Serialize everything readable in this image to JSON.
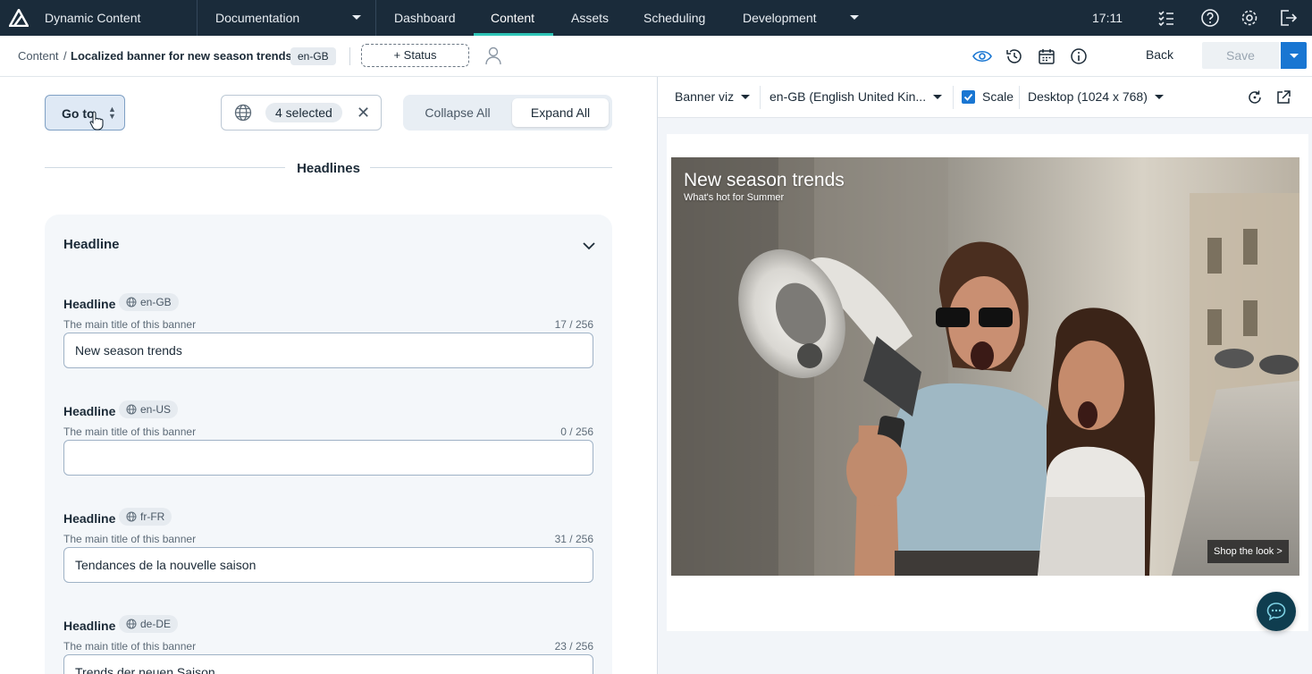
{
  "topnav": {
    "app_name": "Dynamic Content",
    "items": [
      "Documentation",
      "Dashboard",
      "Content",
      "Assets",
      "Scheduling",
      "Development"
    ],
    "active_item": "Content",
    "clock": "17:11",
    "icons": [
      "logo-icon",
      "tasks-icon",
      "help-icon",
      "gear-icon",
      "logout-icon"
    ]
  },
  "breadcrumb": {
    "root": "Content",
    "separator": "/",
    "current": "Localized banner for new season trends",
    "locale": "en-GB",
    "status_button": "+ Status"
  },
  "actions": {
    "back": "Back",
    "save": "Save",
    "icons": [
      "eye-icon",
      "history-icon",
      "calendar-icon",
      "info-icon"
    ]
  },
  "toolbar": {
    "goto": "Go to",
    "locales_selected": "4 selected",
    "collapse_all": "Collapse All",
    "expand_all": "Expand All"
  },
  "section": {
    "title": "Headlines",
    "card_title": "Headline",
    "fields": [
      {
        "label": "Headline",
        "locale": "en-GB",
        "description": "The main title of this banner",
        "count": "17 / 256",
        "value": "New season trends"
      },
      {
        "label": "Headline",
        "locale": "en-US",
        "description": "The main title of this banner",
        "count": "0 / 256",
        "value": ""
      },
      {
        "label": "Headline",
        "locale": "fr-FR",
        "description": "The main title of this banner",
        "count": "31 / 256",
        "value": "Tendances de la nouvelle saison"
      },
      {
        "label": "Headline",
        "locale": "de-DE",
        "description": "The main title of this banner",
        "count": "23 / 256",
        "value": "Trends der neuen Saison"
      }
    ]
  },
  "preview": {
    "viz": "Banner viz",
    "locale": "en-GB (English United Kin...",
    "scale_label": "Scale",
    "scale_checked": true,
    "device": "Desktop (1024 x 768)",
    "banner": {
      "headline": "New season trends",
      "subheadline": "What's hot for Summer",
      "cta": "Shop the look >"
    }
  },
  "colors": {
    "nav_bg": "#1a2b3a",
    "accent": "#2ec4b6",
    "primary": "#1976d2"
  }
}
